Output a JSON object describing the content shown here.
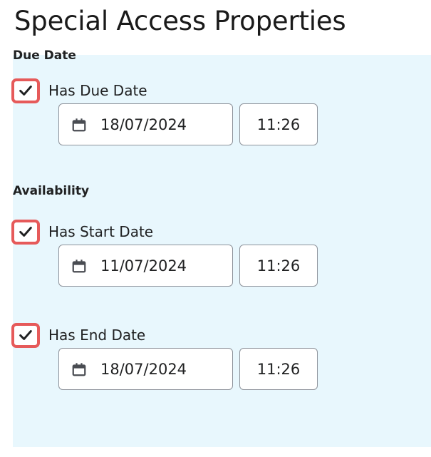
{
  "page": {
    "title": "Special Access Properties"
  },
  "due_date": {
    "section_label": "Due Date",
    "checkbox_label": "Has Due Date",
    "checked": true,
    "date": "18/07/2024",
    "time": "11:26"
  },
  "availability": {
    "section_label": "Availability",
    "start": {
      "checkbox_label": "Has Start Date",
      "checked": true,
      "date": "11/07/2024",
      "time": "11:26"
    },
    "end": {
      "checkbox_label": "Has End Date",
      "checked": true,
      "date": "18/07/2024",
      "time": "11:26"
    }
  },
  "icons": {
    "checkbox": "checkmark-icon",
    "date_picker": "calendar-icon"
  },
  "colors": {
    "highlight": "#e65a5a",
    "panel_bg": "#e8f7fd"
  }
}
